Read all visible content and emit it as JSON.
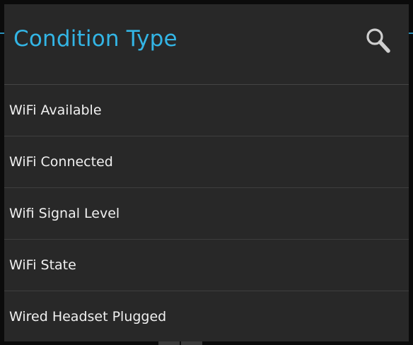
{
  "dialog": {
    "title": "Condition Type",
    "search_icon": "search-icon",
    "accent_color": "#33b5e5",
    "background_color": "#282828"
  },
  "items": [
    {
      "label": "WiFi Available"
    },
    {
      "label": "WiFi Connected"
    },
    {
      "label": "Wifi Signal Level"
    },
    {
      "label": "WiFi State"
    },
    {
      "label": "Wired Headset Plugged"
    }
  ]
}
